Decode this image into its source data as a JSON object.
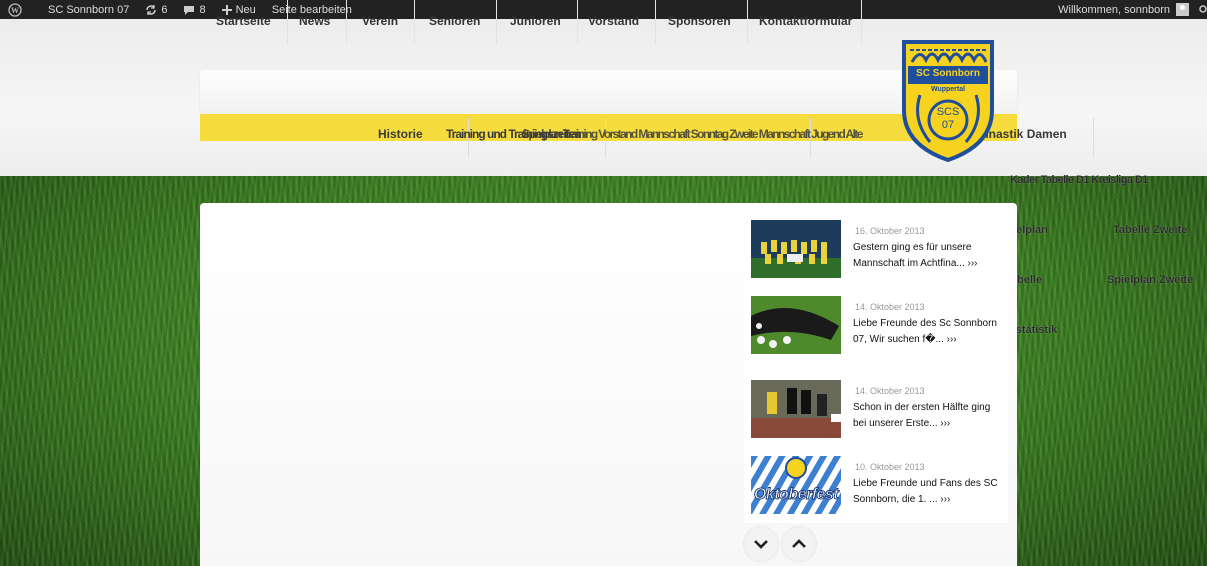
{
  "adminbar": {
    "site_name": "SC Sonnborn 07",
    "updates_count": "6",
    "comments_count": "8",
    "new_label": "Neu",
    "edit_label": "Seite bearbeiten",
    "welcome": "Willkommen, sonnborn"
  },
  "logo": {
    "title": "SC Sonnborn",
    "subtitle": "Wuppertal",
    "badge_line1": "SCS",
    "badge_line2": "07",
    "colors": {
      "blue": "#1e4e9c",
      "yellow": "#f7d21e"
    }
  },
  "nav": {
    "items": [
      "Startseite",
      "News",
      "Verein",
      "Senioren",
      "Junioren",
      "Vorstand",
      "Sponsoren",
      "Kontaktformular"
    ],
    "sub": {
      "historie": "Historie",
      "overlap1": "Training und Trainingszeiten",
      "overlap2": "Spielplan Training Vorstand Mannschaft Sonntag Zweite Mannschaft Jugend Alte",
      "gymnastik": "Gymnastik Damen"
    },
    "accent": "#f6dc3c"
  },
  "overflow": {
    "row1": "Kader Tabelle D1 Kreisliga D1",
    "spielplan": "Spielplan",
    "tabelle_zweite": "Tabelle Zweite",
    "tabelle": "Tabelle",
    "spielplan_zweite": "Spielplan Zweite",
    "spielerstatistik": "Spielerstatistik"
  },
  "news": [
    {
      "date": "16. Oktober 2013",
      "text": "Gestern ging es für unsere Mannschaft im Achtfina...",
      "more": "›››"
    },
    {
      "date": "14. Oktober 2013",
      "text": "Liebe Freunde des Sc Sonnborn 07, Wir suchen f�...",
      "more": "›››"
    },
    {
      "date": "14. Oktober 2013",
      "text": "Schon in der ersten Hälfte ging bei unserer Erste...",
      "more": "›››"
    },
    {
      "date": "10. Oktober 2013",
      "text": "Liebe Freunde und Fans des SC Sonnborn, die 1. ...",
      "more": "›››",
      "thumb_label": "Oktoberfest"
    }
  ],
  "controls": {
    "down_icon": "chevron-down-icon",
    "up_icon": "chevron-up-icon"
  }
}
